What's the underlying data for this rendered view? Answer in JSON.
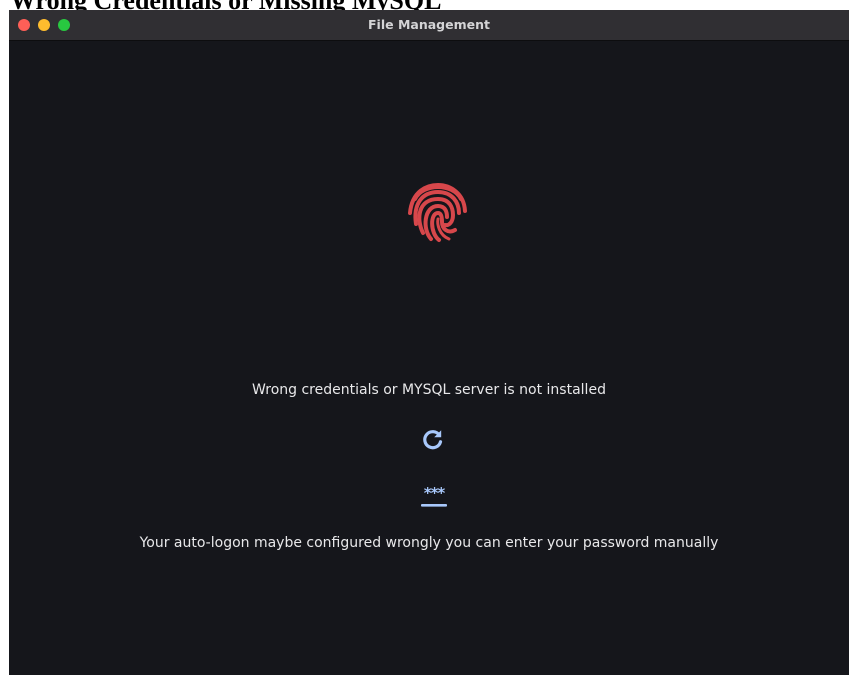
{
  "document": {
    "heading": "Wrong Credentials or Missing MySQL"
  },
  "window": {
    "title": "File Management",
    "controls": {
      "close": "close-icon",
      "minimize": "minimize-icon",
      "zoom": "zoom-icon"
    }
  },
  "main": {
    "fingerprint_icon": "fingerprint-icon",
    "fingerprint_color": "#d7474b",
    "error_message": "Wrong credentials or MYSQL server is not installed",
    "refresh_icon": "refresh-icon",
    "password_icon": "password-icon",
    "action_color": "#a8c8fb",
    "hint_message": "Your auto-logon maybe configured wrongly you can enter your password manually"
  },
  "colors": {
    "window_background": "#15161b",
    "titlebar": "#302f33",
    "text": "#e8e8ea"
  }
}
